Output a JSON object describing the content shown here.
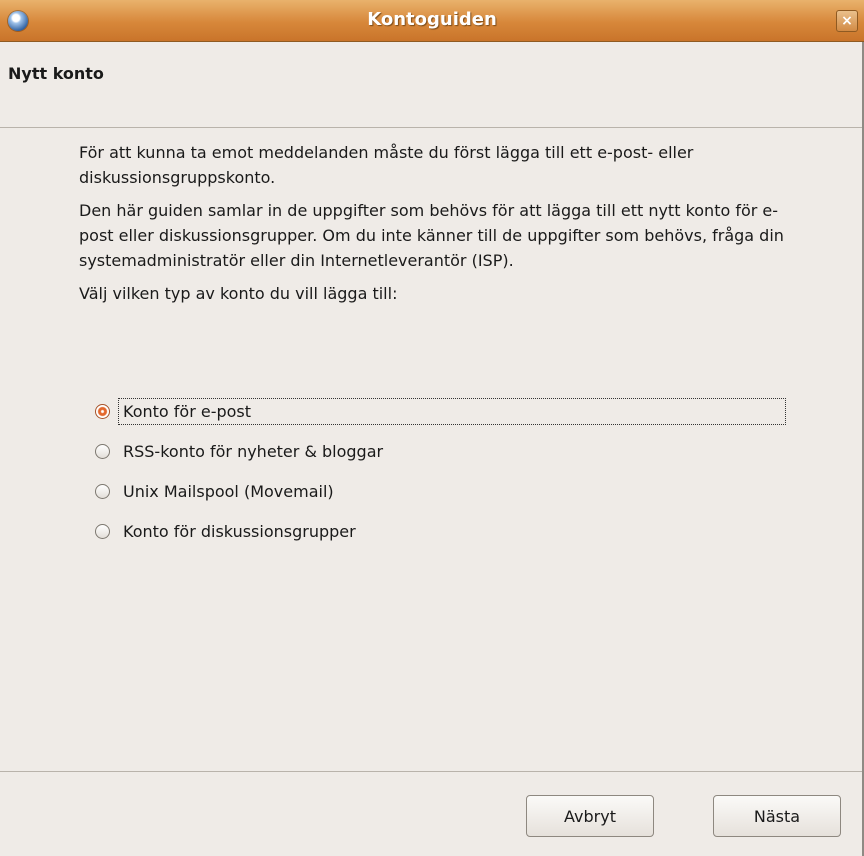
{
  "window": {
    "title": "Kontoguiden",
    "close_glyph": "×",
    "app_icon": "thunderbird-icon"
  },
  "header": {
    "title": "Nytt konto"
  },
  "content": {
    "paragraph1": "För att kunna ta emot meddelanden måste du först lägga till ett e-post- eller diskussionsgruppskonto.",
    "paragraph2": "Den här guiden samlar in de uppgifter som behövs för att lägga till ett nytt konto för e-post eller diskussionsgrupper. Om du inte känner till de uppgifter som behövs, fråga din systemadministratör eller din Internetleverantör (ISP).",
    "prompt": "Välj vilken typ av konto du vill lägga till:"
  },
  "account_types": [
    {
      "label": "Konto för e-post",
      "selected": true
    },
    {
      "label": "RSS-konto för nyheter & bloggar",
      "selected": false
    },
    {
      "label": "Unix Mailspool (Movemail)",
      "selected": false
    },
    {
      "label": "Konto för diskussionsgrupper",
      "selected": false
    }
  ],
  "buttons": {
    "cancel": "Avbryt",
    "next": "Nästa"
  },
  "colors": {
    "titlebar": "#d7873a",
    "radio_selected": "#e3672c",
    "background": "#efebe7"
  }
}
